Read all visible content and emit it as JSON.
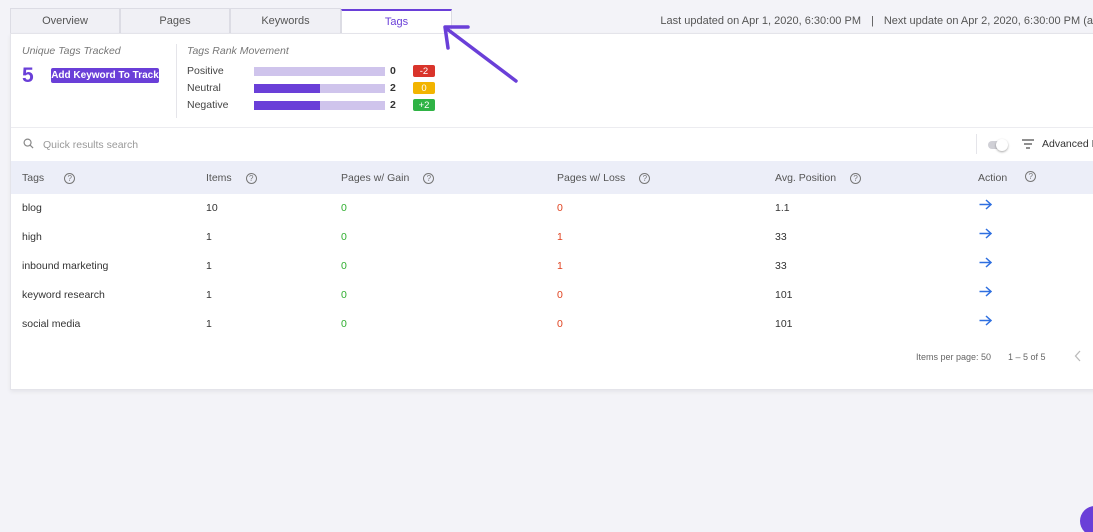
{
  "tabs": [
    {
      "label": "Overview"
    },
    {
      "label": "Pages"
    },
    {
      "label": "Keywords"
    },
    {
      "label": "Tags"
    }
  ],
  "update_info": {
    "last_updated": "Last updated on Apr 1, 2020, 6:30:00 PM",
    "separator": "|",
    "next_update": "Next update on Apr 2, 2020, 6:30:00 PM (a"
  },
  "summary": {
    "unique_label": "Unique Tags Tracked",
    "unique_count": "5",
    "add_button": "Add Keyword To Track",
    "movement_label": "Tags Rank Movement",
    "movement": [
      {
        "label": "Positive",
        "count": "0",
        "badge": "-2",
        "badge_color": "#d9342b",
        "fill_fraction": 0.0
      },
      {
        "label": "Neutral",
        "count": "2",
        "badge": "0",
        "badge_color": "#f2b400",
        "fill_fraction": 0.5
      },
      {
        "label": "Negative",
        "count": "2",
        "badge": "+2",
        "badge_color": "#2fb345",
        "fill_fraction": 0.5
      }
    ]
  },
  "search": {
    "placeholder": "Quick results search"
  },
  "advanced_filter": "Advanced Fi",
  "table": {
    "columns": [
      "Tags",
      "Items",
      "Pages w/ Gain",
      "Pages w/ Loss",
      "Avg. Position",
      "Action"
    ],
    "rows": [
      {
        "tag": "blog",
        "items": "10",
        "gain": "0",
        "loss": "0",
        "avg": "1.1"
      },
      {
        "tag": "high",
        "items": "1",
        "gain": "0",
        "loss": "1",
        "avg": "33"
      },
      {
        "tag": "inbound marketing",
        "items": "1",
        "gain": "0",
        "loss": "1",
        "avg": "33"
      },
      {
        "tag": "keyword research",
        "items": "1",
        "gain": "0",
        "loss": "0",
        "avg": "101"
      },
      {
        "tag": "social media",
        "items": "1",
        "gain": "0",
        "loss": "0",
        "avg": "101"
      }
    ]
  },
  "pagination": {
    "items_per_page": "Items per page: 50",
    "range": "1 – 5 of 5"
  },
  "colors": {
    "accent": "#6a3fd8",
    "gain": "#2fae2f",
    "loss": "#e0421f",
    "arrow": "#2e6fe0"
  }
}
